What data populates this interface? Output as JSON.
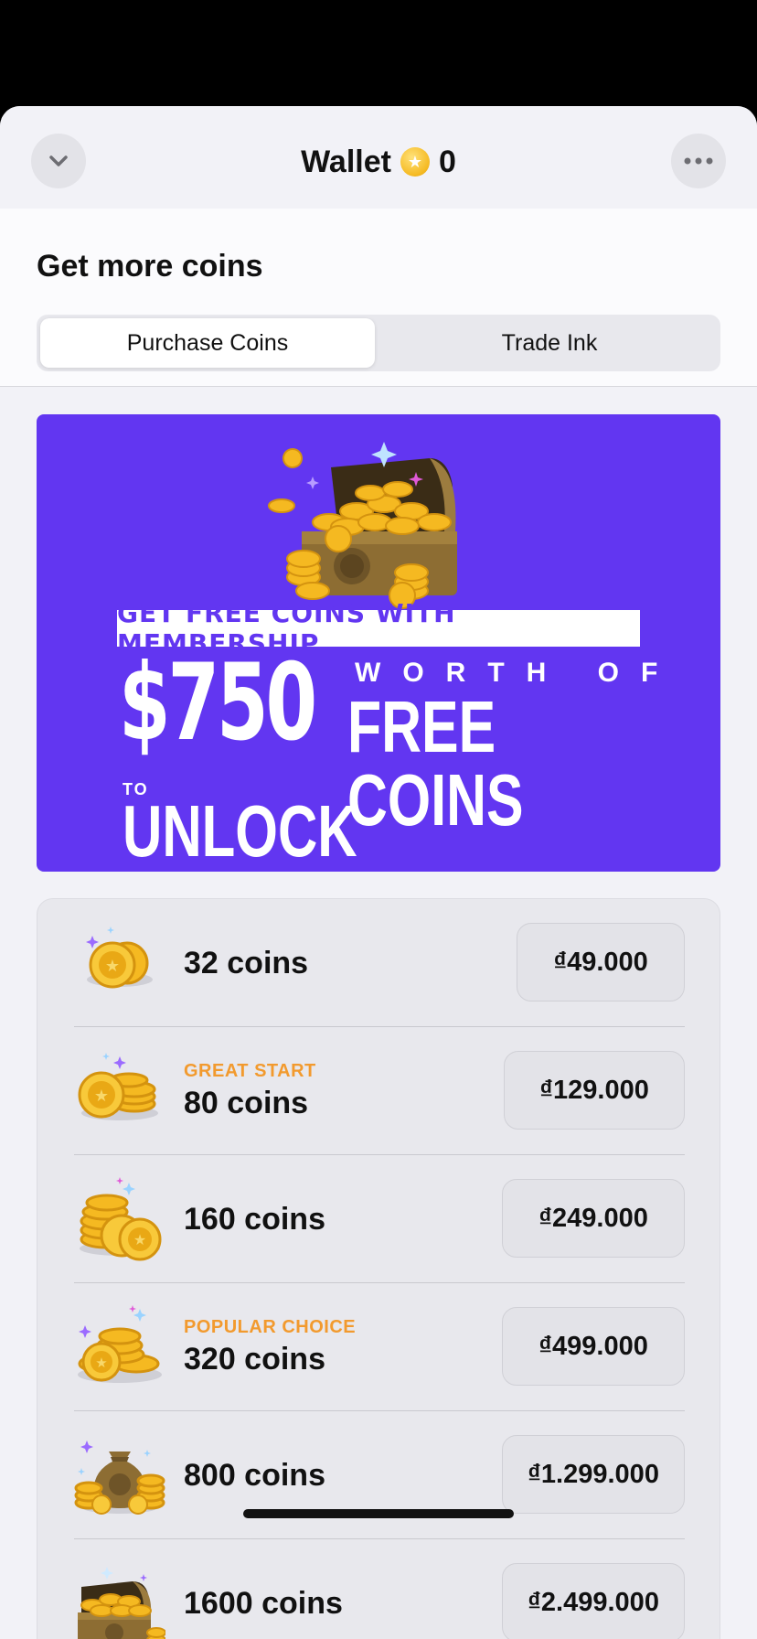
{
  "header": {
    "title": "Wallet",
    "balance": "0",
    "collapse_icon": "chevron-down-icon",
    "more_icon": "more-horizontal-icon"
  },
  "section": {
    "title": "Get more coins"
  },
  "tabs": [
    {
      "label": "Purchase Coins",
      "selected": true
    },
    {
      "label": "Trade Ink",
      "selected": false
    }
  ],
  "banner": {
    "tag": "GET FREE COINS WITH MEMBERSHIP",
    "amount": "$750",
    "worth_of": "WORTH OF",
    "free_coins": "FREE COINS",
    "to": "TO",
    "unlock": "UNLOCK LATEST HITS",
    "background": "#6236f1"
  },
  "packages": [
    {
      "badge": "",
      "coins": "32 coins",
      "price": "₫49.000",
      "icon": "coin-pair-icon"
    },
    {
      "badge": "GREAT START",
      "coins": "80 coins",
      "price": "₫129.000",
      "icon": "coin-stack-icon"
    },
    {
      "badge": "",
      "coins": "160 coins",
      "price": "₫249.000",
      "icon": "coin-pile-icon"
    },
    {
      "badge": "POPULAR CHOICE",
      "coins": "320 coins",
      "price": "₫499.000",
      "icon": "coin-heap-icon"
    },
    {
      "badge": "",
      "coins": "800 coins",
      "price": "₫1.299.000",
      "icon": "coin-bag-icon"
    },
    {
      "badge": "",
      "coins": "1600 coins",
      "price": "₫2.499.000",
      "icon": "treasure-chest-icon"
    }
  ],
  "colors": {
    "accent_orange": "#f29a2e",
    "banner_purple": "#6236f1",
    "coin_gold": "#f5b921"
  }
}
